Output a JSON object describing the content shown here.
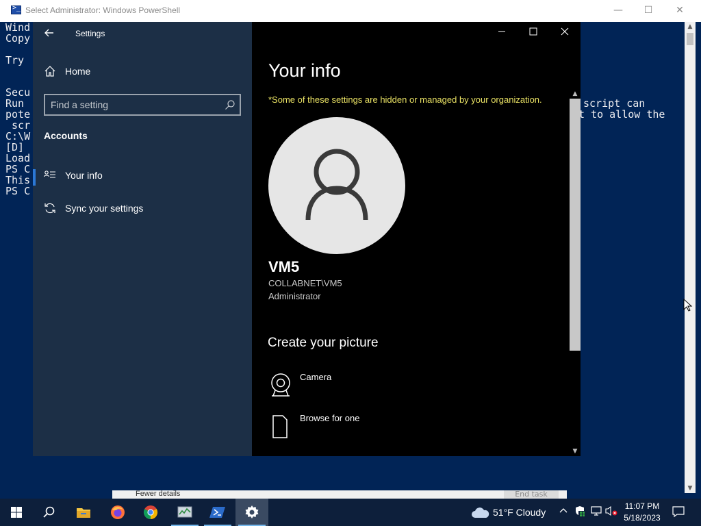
{
  "powershell": {
    "title": "Select Administrator: Windows PowerShell",
    "lines": [
      "Wind",
      "Copy",
      "",
      "Try",
      "",
      "Secu",
      "Run",
      "pote",
      " scr",
      "C:\\W",
      "[D]",
      "Load",
      "PS C",
      "This",
      "PS C"
    ],
    "right_lines": [
      "script can",
      "t to allow the"
    ],
    "minimize_glyph": "—",
    "maximize_glyph": "☐",
    "close_glyph": "✕"
  },
  "task_manager": {
    "fewer_details": "Fewer details",
    "end_task": "End task"
  },
  "settings": {
    "app_title": "Settings",
    "home_label": "Home",
    "search_placeholder": "Find a setting",
    "section_heading": "Accounts",
    "nav_items": [
      {
        "label": "Your info",
        "icon": "person-list-icon",
        "selected": true
      },
      {
        "label": "Sync your settings",
        "icon": "sync-icon",
        "selected": false
      }
    ],
    "page_title": "Your info",
    "org_note": "*Some of these settings are hidden or managed by your organization.",
    "user": {
      "name": "VM5",
      "domain": "COLLABNET\\VM5",
      "role": "Administrator"
    },
    "create_picture_heading": "Create your picture",
    "picture_options": [
      {
        "label": "Camera",
        "icon": "camera-icon"
      },
      {
        "label": "Browse for one",
        "icon": "file-icon"
      }
    ],
    "colors": {
      "nav_bg": "#1c2f46",
      "content_bg": "#000000",
      "accent": "#2b78d6",
      "note_yellow": "#ece465"
    }
  },
  "taskbar": {
    "apps": [
      "start-icon",
      "search-icon",
      "file-explorer-icon",
      "firefox-icon",
      "chrome-icon",
      "task-manager-icon",
      "powershell-icon",
      "settings-gear-icon"
    ],
    "weather": "51°F  Cloudy",
    "time": "11:07 PM",
    "date": "5/18/2023"
  }
}
